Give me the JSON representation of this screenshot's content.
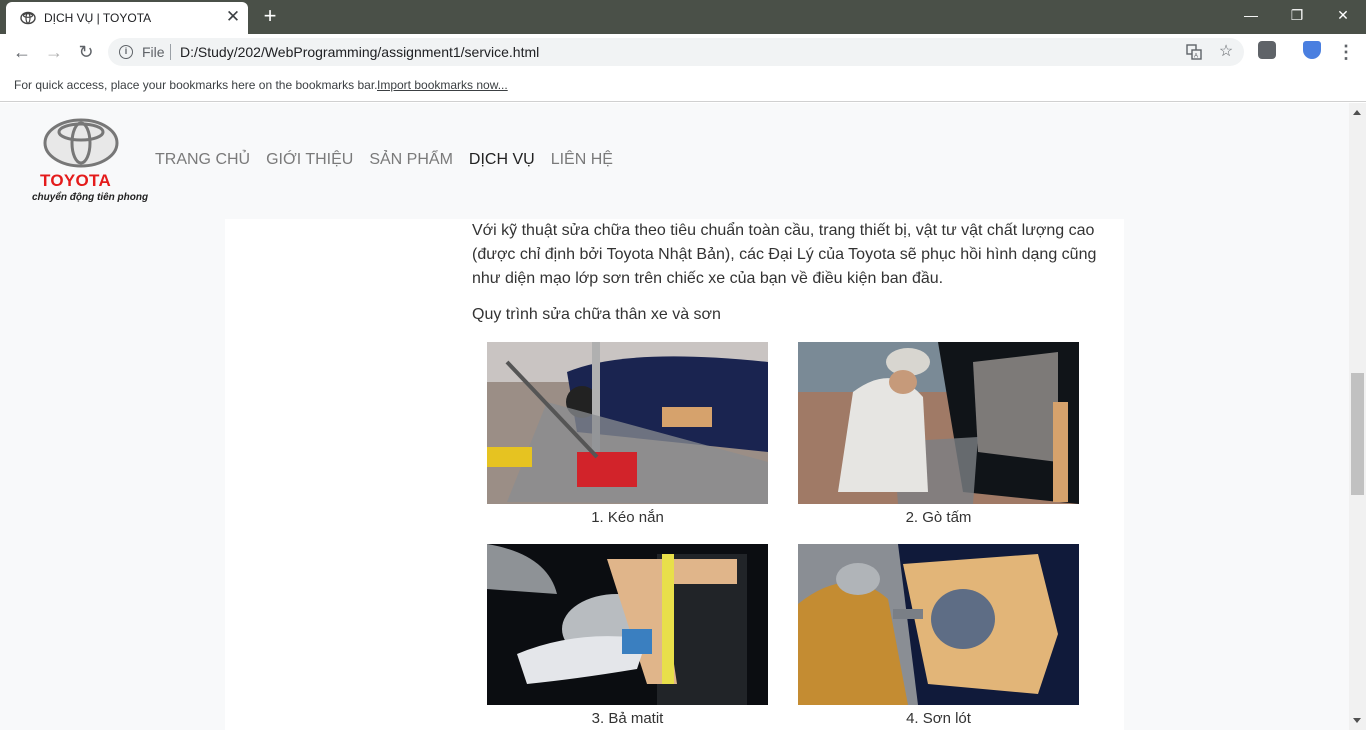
{
  "browser": {
    "tab_title": "DỊCH VỤ | TOYOTA",
    "url_scheme": "File",
    "url": "D:/Study/202/WebProgramming/assignment1/service.html",
    "bookmarks_prompt": "For quick access, place your bookmarks here on the bookmarks bar.",
    "import_bookmarks": "Import bookmarks now..."
  },
  "site": {
    "logo_word": "TOYOTA",
    "logo_tagline": "chuyển động tiên phong",
    "brand_color": "#e41b1b",
    "menu": [
      {
        "label": "TRANG CHỦ",
        "active": false
      },
      {
        "label": "GIỚI THIỆU",
        "active": false
      },
      {
        "label": "SẢN PHẨM",
        "active": false
      },
      {
        "label": "DỊCH VỤ",
        "active": true
      },
      {
        "label": "LIÊN HỆ",
        "active": false
      }
    ]
  },
  "content": {
    "paragraph": "Với kỹ thuật sửa chữa theo tiêu chuẩn toàn cầu, trang thiết bị, vật tư vật chất lượng cao (được chỉ định bởi Toyota Nhật Bản), các Đại Lý của Toyota sẽ phục hồi hình dạng cũng như diện mạo lớp sơn trên chiếc xe của bạn về điều kiện ban đầu.",
    "subheading": "Quy trình sửa chữa thân xe và sơn",
    "steps": [
      {
        "caption": "1. Kéo nắn"
      },
      {
        "caption": "2. Gò tấm"
      },
      {
        "caption": "3. Bả matit"
      },
      {
        "caption": "4. Sơn lót"
      }
    ]
  }
}
